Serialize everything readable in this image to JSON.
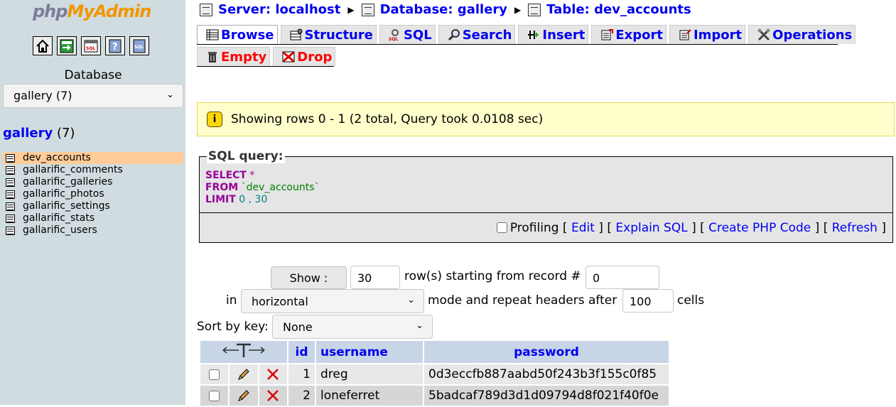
{
  "left": {
    "logo": {
      "php": "php",
      "my": "My",
      "admin": "Admin"
    },
    "db_label": "Database",
    "db_select": "gallery (7)",
    "db_heading": {
      "name": "gallery",
      "count": "(7)"
    },
    "tables": [
      "dev_accounts",
      "gallarific_comments",
      "gallarific_galleries",
      "gallarific_photos",
      "gallarific_settings",
      "gallarific_stats",
      "gallarific_users"
    ]
  },
  "breadcrumb": {
    "server": "Server: localhost",
    "database": "Database: gallery",
    "table": "Table: dev_accounts"
  },
  "tabs": {
    "browse": "Browse",
    "structure": "Structure",
    "sql": "SQL",
    "search": "Search",
    "insert": "Insert",
    "export": "Export",
    "import": "Import",
    "operations": "Operations",
    "empty": "Empty",
    "drop": "Drop"
  },
  "notice": "Showing rows 0 - 1 (2 total, Query took 0.0108 sec)",
  "sql": {
    "legend": "SQL query:",
    "select_kw": "SELECT",
    "select_rest": " *",
    "from_kw": "FROM",
    "from_table": " `dev_accounts`",
    "limit_kw": "LIMIT",
    "limit_a": " 0",
    "limit_sep": " , ",
    "limit_b": "30"
  },
  "tools": {
    "profiling": "Profiling",
    "edit": "Edit",
    "explain": "Explain SQL",
    "php": "Create PHP Code",
    "refresh": "Refresh"
  },
  "nav": {
    "show_button": "Show :",
    "rows_value": "30",
    "rows_text": "row(s) starting from record #",
    "start_value": "0",
    "in_text": "in",
    "mode_value": "horizontal",
    "repeat_text": "mode and repeat headers after",
    "repeat_value": "100",
    "cells_text": "cells",
    "sort_label": "Sort by key:",
    "sort_value": "None"
  },
  "results": {
    "columns": {
      "id": "id",
      "username": "username",
      "password": "password"
    },
    "rows": [
      {
        "id": "1",
        "username": "dreg",
        "password": "0d3eccfb887aabd50f243b3f155c0f85"
      },
      {
        "id": "2",
        "username": "loneferret",
        "password": "5badcaf789d3d1d09794d8f021f40f0e"
      }
    ]
  },
  "colors": {
    "link": "#0000ee",
    "left_bg": "#d0dce0",
    "active_table": "#ffcc99",
    "notice_bg": "#ffffcc",
    "danger": "#ff0000"
  }
}
